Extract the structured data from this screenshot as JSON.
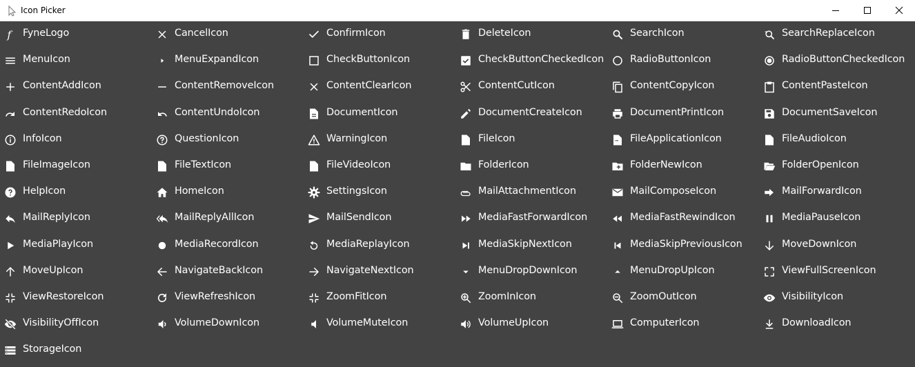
{
  "window": {
    "title": "Icon Picker"
  },
  "icons": [
    {
      "label": "FyneLogo",
      "icon": "fyne-logo-icon"
    },
    {
      "label": "CancelIcon",
      "icon": "cancel-icon"
    },
    {
      "label": "ConfirmIcon",
      "icon": "confirm-icon"
    },
    {
      "label": "DeleteIcon",
      "icon": "delete-icon"
    },
    {
      "label": "SearchIcon",
      "icon": "search-icon"
    },
    {
      "label": "SearchReplaceIcon",
      "icon": "search-replace-icon"
    },
    {
      "label": "MenuIcon",
      "icon": "menu-icon"
    },
    {
      "label": "MenuExpandIcon",
      "icon": "menu-expand-icon"
    },
    {
      "label": "CheckButtonIcon",
      "icon": "check-button-icon"
    },
    {
      "label": "CheckButtonCheckedIcon",
      "icon": "check-button-checked-icon"
    },
    {
      "label": "RadioButtonIcon",
      "icon": "radio-button-icon"
    },
    {
      "label": "RadioButtonCheckedIcon",
      "icon": "radio-button-checked-icon"
    },
    {
      "label": "ContentAddIcon",
      "icon": "content-add-icon"
    },
    {
      "label": "ContentRemoveIcon",
      "icon": "content-remove-icon"
    },
    {
      "label": "ContentClearIcon",
      "icon": "content-clear-icon"
    },
    {
      "label": "ContentCutIcon",
      "icon": "content-cut-icon"
    },
    {
      "label": "ContentCopyIcon",
      "icon": "content-copy-icon"
    },
    {
      "label": "ContentPasteIcon",
      "icon": "content-paste-icon"
    },
    {
      "label": "ContentRedoIcon",
      "icon": "content-redo-icon"
    },
    {
      "label": "ContentUndoIcon",
      "icon": "content-undo-icon"
    },
    {
      "label": "DocumentIcon",
      "icon": "document-icon"
    },
    {
      "label": "DocumentCreateIcon",
      "icon": "document-create-icon"
    },
    {
      "label": "DocumentPrintIcon",
      "icon": "document-print-icon"
    },
    {
      "label": "DocumentSaveIcon",
      "icon": "document-save-icon"
    },
    {
      "label": "InfoIcon",
      "icon": "info-icon"
    },
    {
      "label": "QuestionIcon",
      "icon": "question-icon"
    },
    {
      "label": "WarningIcon",
      "icon": "warning-icon"
    },
    {
      "label": "FileIcon",
      "icon": "file-icon"
    },
    {
      "label": "FileApplicationIcon",
      "icon": "file-application-icon"
    },
    {
      "label": "FileAudioIcon",
      "icon": "file-audio-icon"
    },
    {
      "label": "FileImageIcon",
      "icon": "file-image-icon"
    },
    {
      "label": "FileTextIcon",
      "icon": "file-text-icon"
    },
    {
      "label": "FileVideoIcon",
      "icon": "file-video-icon"
    },
    {
      "label": "FolderIcon",
      "icon": "folder-icon"
    },
    {
      "label": "FolderNewIcon",
      "icon": "folder-new-icon"
    },
    {
      "label": "FolderOpenIcon",
      "icon": "folder-open-icon"
    },
    {
      "label": "HelpIcon",
      "icon": "help-icon"
    },
    {
      "label": "HomeIcon",
      "icon": "home-icon"
    },
    {
      "label": "SettingsIcon",
      "icon": "settings-icon"
    },
    {
      "label": "MailAttachmentIcon",
      "icon": "mail-attachment-icon"
    },
    {
      "label": "MailComposeIcon",
      "icon": "mail-compose-icon"
    },
    {
      "label": "MailForwardIcon",
      "icon": "mail-forward-icon"
    },
    {
      "label": "MailReplyIcon",
      "icon": "mail-reply-icon"
    },
    {
      "label": "MailReplyAllIcon",
      "icon": "mail-reply-all-icon"
    },
    {
      "label": "MailSendIcon",
      "icon": "mail-send-icon"
    },
    {
      "label": "MediaFastForwardIcon",
      "icon": "media-fast-forward-icon"
    },
    {
      "label": "MediaFastRewindIcon",
      "icon": "media-fast-rewind-icon"
    },
    {
      "label": "MediaPauseIcon",
      "icon": "media-pause-icon"
    },
    {
      "label": "MediaPlayIcon",
      "icon": "media-play-icon"
    },
    {
      "label": "MediaRecordIcon",
      "icon": "media-record-icon"
    },
    {
      "label": "MediaReplayIcon",
      "icon": "media-replay-icon"
    },
    {
      "label": "MediaSkipNextIcon",
      "icon": "media-skip-next-icon"
    },
    {
      "label": "MediaSkipPreviousIcon",
      "icon": "media-skip-previous-icon"
    },
    {
      "label": "MoveDownIcon",
      "icon": "move-down-icon"
    },
    {
      "label": "MoveUpIcon",
      "icon": "move-up-icon"
    },
    {
      "label": "NavigateBackIcon",
      "icon": "navigate-back-icon"
    },
    {
      "label": "NavigateNextIcon",
      "icon": "navigate-next-icon"
    },
    {
      "label": "MenuDropDownIcon",
      "icon": "menu-drop-down-icon"
    },
    {
      "label": "MenuDropUpIcon",
      "icon": "menu-drop-up-icon"
    },
    {
      "label": "ViewFullScreenIcon",
      "icon": "view-full-screen-icon"
    },
    {
      "label": "ViewRestoreIcon",
      "icon": "view-restore-icon"
    },
    {
      "label": "ViewRefreshIcon",
      "icon": "view-refresh-icon"
    },
    {
      "label": "ZoomFitIcon",
      "icon": "zoom-fit-icon"
    },
    {
      "label": "ZoomInIcon",
      "icon": "zoom-in-icon"
    },
    {
      "label": "ZoomOutIcon",
      "icon": "zoom-out-icon"
    },
    {
      "label": "VisibilityIcon",
      "icon": "visibility-icon"
    },
    {
      "label": "VisibilityOffIcon",
      "icon": "visibility-off-icon"
    },
    {
      "label": "VolumeDownIcon",
      "icon": "volume-down-icon"
    },
    {
      "label": "VolumeMuteIcon",
      "icon": "volume-mute-icon"
    },
    {
      "label": "VolumeUpIcon",
      "icon": "volume-up-icon"
    },
    {
      "label": "ComputerIcon",
      "icon": "computer-icon"
    },
    {
      "label": "DownloadIcon",
      "icon": "download-icon"
    },
    {
      "label": "StorageIcon",
      "icon": "storage-icon"
    }
  ]
}
